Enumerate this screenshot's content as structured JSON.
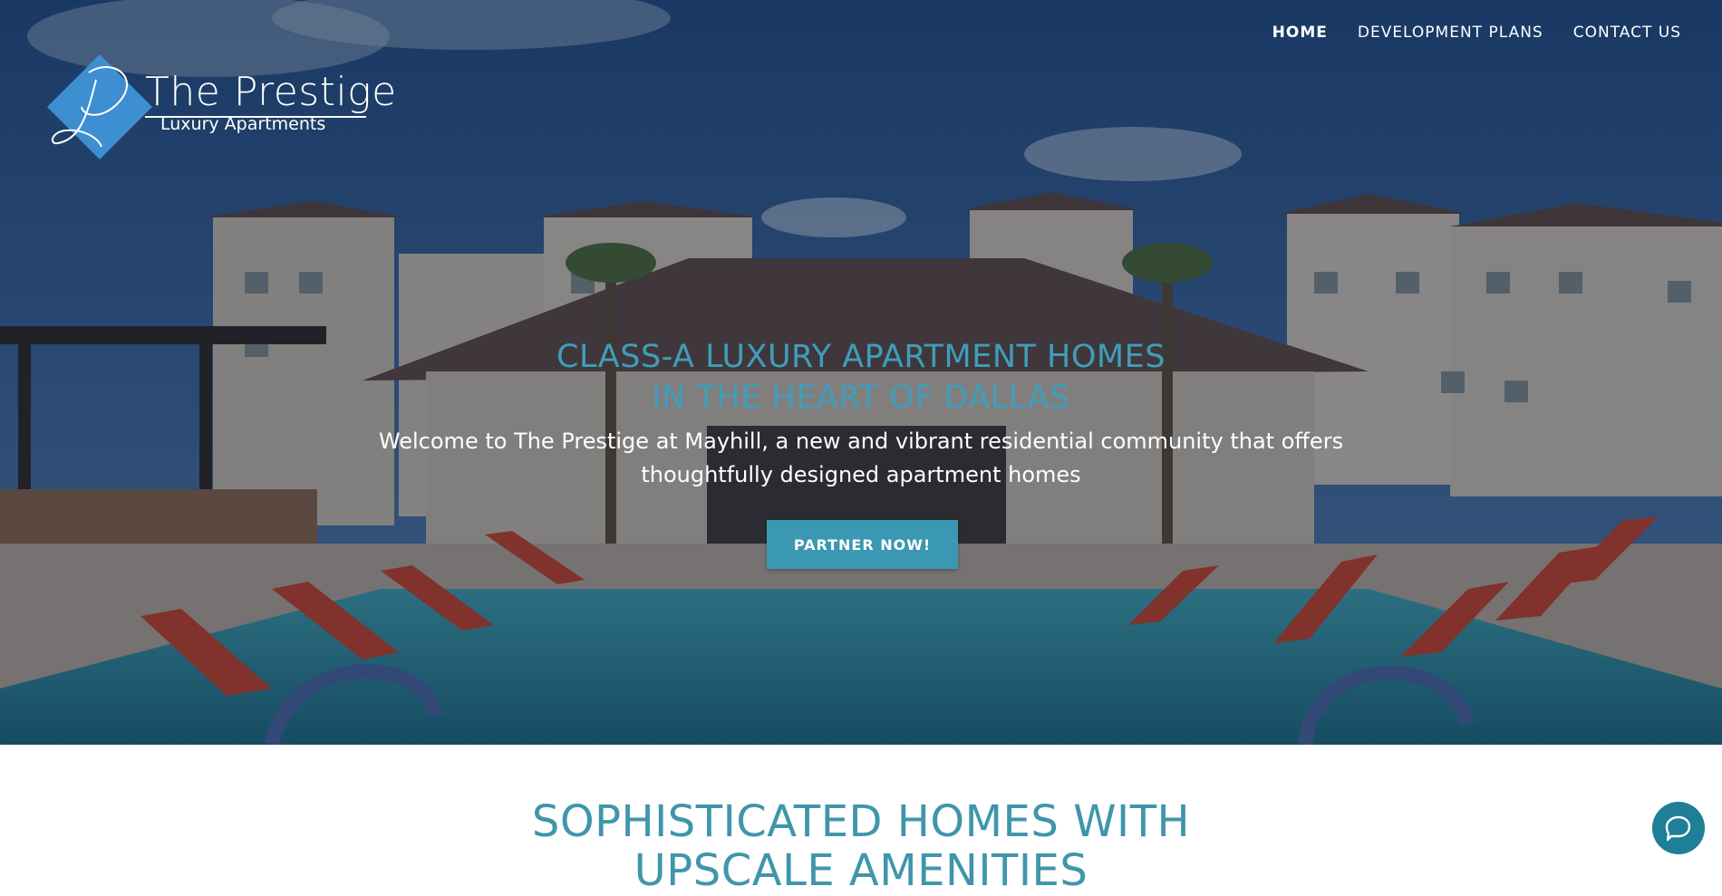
{
  "nav": {
    "items": [
      {
        "label": "HOME",
        "active": true
      },
      {
        "label": "DEVELOPMENT PLANS",
        "active": false
      },
      {
        "label": "CONTACT US",
        "active": false
      }
    ]
  },
  "logo": {
    "title": "The Prestige",
    "subtitle": "Luxury Apartments",
    "mark_letter": "P"
  },
  "hero": {
    "title_line1": "CLASS-A LUXURY APARTMENT HOMES",
    "title_line2": "IN THE HEART OF DALLAS",
    "text": "Welcome to The Prestige at Mayhill, a new and vibrant residential community that offers thoughtfully designed apartment homes",
    "cta_label": "PARTNER NOW!"
  },
  "section": {
    "title_line1": "SOPHISTICATED HOMES WITH",
    "title_line2": "UPSCALE AMENITIES"
  },
  "chat": {
    "icon": "chat-bubble-icon"
  },
  "colors": {
    "accent": "#3a98b2",
    "heading_teal": "#3f96aa",
    "logo_diamond": "#3d8fd1",
    "chat": "#1e7f97"
  }
}
